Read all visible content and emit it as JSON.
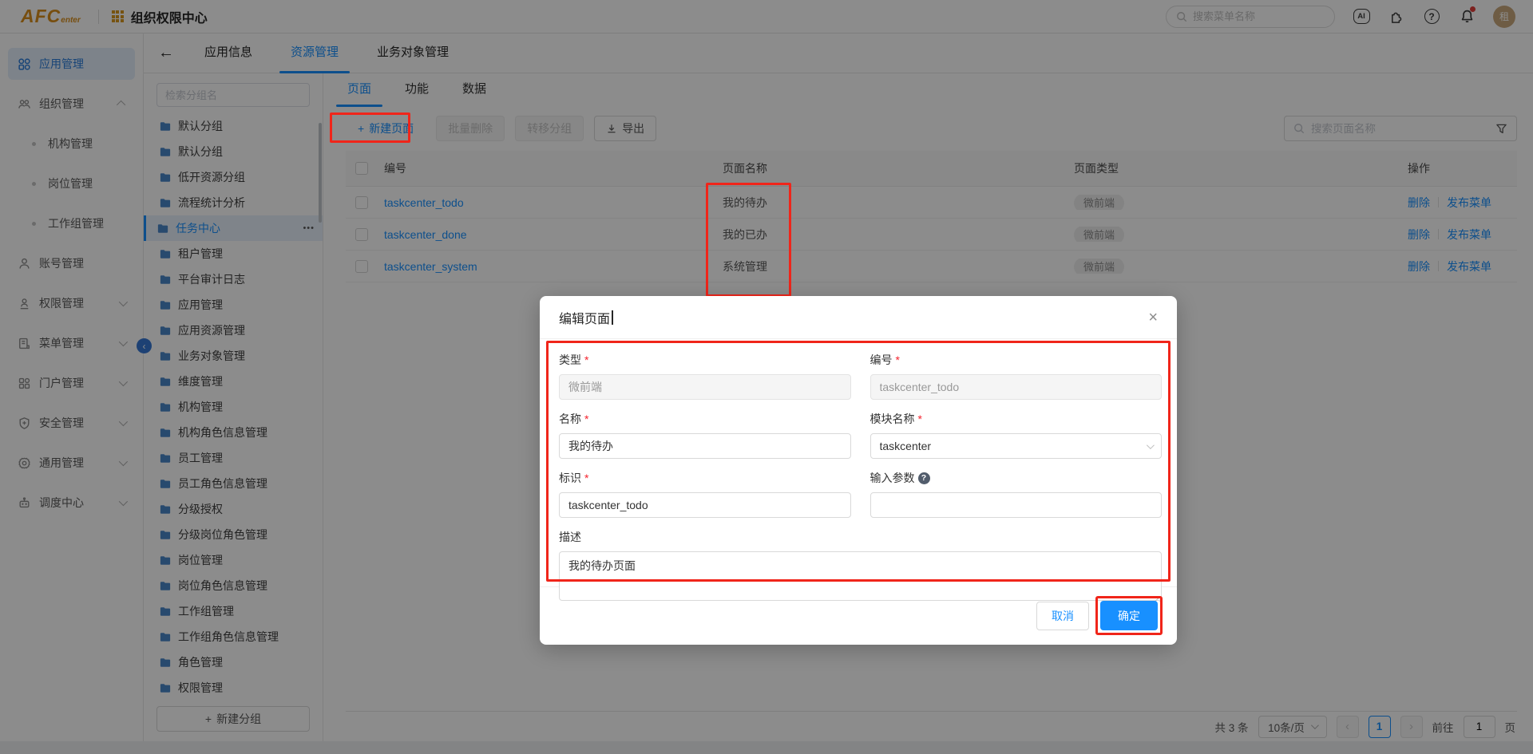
{
  "header": {
    "logo_main": "AFC",
    "logo_sub": "enter",
    "app_title": "组织权限中心",
    "search_placeholder": "搜索菜单名称",
    "ai_label": "AI",
    "help_glyph": "?",
    "avatar_text": "租"
  },
  "sidebar": {
    "items": [
      {
        "label": "应用管理",
        "icon": "app-grid-icon",
        "active": true
      },
      {
        "label": "组织管理",
        "icon": "org-icon",
        "chevron": "up"
      },
      {
        "label": "机构管理",
        "child": true
      },
      {
        "label": "岗位管理",
        "child": true
      },
      {
        "label": "工作组管理",
        "child": true
      },
      {
        "label": "账号管理",
        "icon": "user-icon"
      },
      {
        "label": "权限管理",
        "icon": "permission-icon",
        "chevron": "down"
      },
      {
        "label": "菜单管理",
        "icon": "menu-doc-icon",
        "chevron": "down"
      },
      {
        "label": "门户管理",
        "icon": "portal-grid-icon",
        "chevron": "down"
      },
      {
        "label": "安全管理",
        "icon": "shield-icon",
        "chevron": "down"
      },
      {
        "label": "通用管理",
        "icon": "gear-icon",
        "chevron": "down"
      },
      {
        "label": "调度中心",
        "icon": "robot-icon",
        "chevron": "down"
      }
    ]
  },
  "tabbar": {
    "back_glyph": "←",
    "tabs": [
      {
        "label": "应用信息"
      },
      {
        "label": "资源管理",
        "active": true
      },
      {
        "label": "业务对象管理"
      }
    ]
  },
  "groups": {
    "search_placeholder": "检索分组名",
    "more_glyph": "•••",
    "new_button": "新建分组",
    "plus_glyph": "+",
    "items": [
      {
        "label": "默认分组"
      },
      {
        "label": "默认分组"
      },
      {
        "label": "低开资源分组"
      },
      {
        "label": "流程统计分析"
      },
      {
        "label": "任务中心",
        "selected": true
      },
      {
        "label": "租户管理"
      },
      {
        "label": "平台审计日志"
      },
      {
        "label": "应用管理"
      },
      {
        "label": "应用资源管理"
      },
      {
        "label": "业务对象管理"
      },
      {
        "label": "维度管理"
      },
      {
        "label": "机构管理"
      },
      {
        "label": "机构角色信息管理"
      },
      {
        "label": "员工管理"
      },
      {
        "label": "员工角色信息管理"
      },
      {
        "label": "分级授权"
      },
      {
        "label": "分级岗位角色管理"
      },
      {
        "label": "岗位管理"
      },
      {
        "label": "岗位角色信息管理"
      },
      {
        "label": "工作组管理"
      },
      {
        "label": "工作组角色信息管理"
      },
      {
        "label": "角色管理"
      },
      {
        "label": "权限管理"
      }
    ]
  },
  "content": {
    "tabs": [
      {
        "label": "页面",
        "active": true
      },
      {
        "label": "功能"
      },
      {
        "label": "数据"
      }
    ],
    "toolbar": {
      "new_page": "新建页面",
      "plus_glyph": "+",
      "batch_delete": "批量删除",
      "transfer_group": "转移分组",
      "export": "导出"
    },
    "search_placeholder": "搜索页面名称"
  },
  "table": {
    "headers": [
      "编号",
      "页面名称",
      "页面类型",
      "操作"
    ],
    "action_delete": "删除",
    "action_publish": "发布菜单",
    "rows": [
      {
        "code": "taskcenter_todo",
        "name": "我的待办",
        "type": "微前端"
      },
      {
        "code": "taskcenter_done",
        "name": "我的已办",
        "type": "微前端"
      },
      {
        "code": "taskcenter_system",
        "name": "系统管理",
        "type": "微前端"
      }
    ]
  },
  "pagination": {
    "total": "共 3 条",
    "page_size": "10条/页",
    "prev_glyph": "‹",
    "current_page": "1",
    "next_glyph": "›",
    "goto_label": "前往",
    "goto_value": "1",
    "unit": "页"
  },
  "modal": {
    "title": "编辑页面",
    "close_glyph": "×",
    "required_mark": "*",
    "fields": {
      "type_label": "类型",
      "type_value": "微前端",
      "code_label": "编号",
      "code_value": "taskcenter_todo",
      "name_label": "名称",
      "name_value": "我的待办",
      "module_label": "模块名称",
      "module_value": "taskcenter",
      "param_label": "输入参数",
      "param_help_glyph": "?",
      "param_value": "",
      "desc_label": "描述",
      "desc_value": "我的待办页面"
    },
    "cancel": "取消",
    "ok": "确定"
  },
  "colors": {
    "primary": "#1890ff",
    "annotation_red": "#f0251a",
    "logo_orange": "#d98f1d"
  }
}
